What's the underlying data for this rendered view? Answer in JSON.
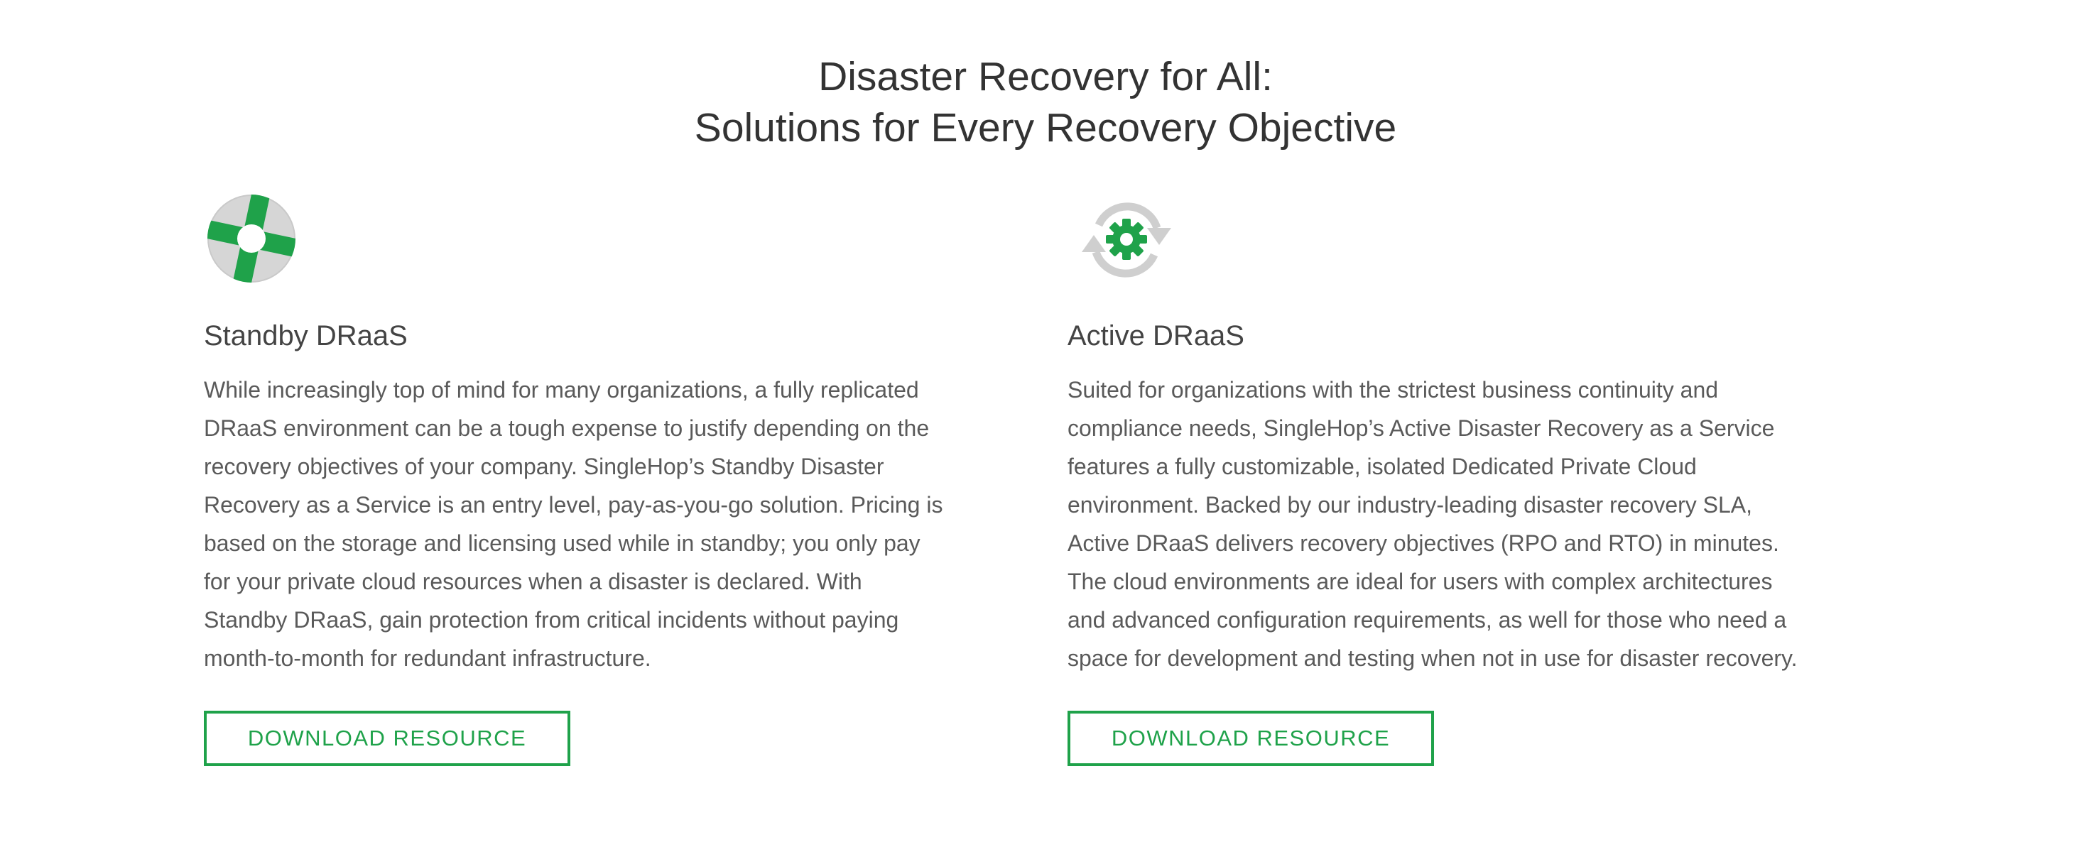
{
  "heading": {
    "line1": "Disaster Recovery for All:",
    "line2": "Solutions for Every Recovery Objective"
  },
  "colors": {
    "accent": "#1fa24a",
    "icon_gray": "#d6d6d6",
    "heading_text": "#333333",
    "body_text": "#5a5a5a"
  },
  "cards": [
    {
      "icon": "lifebuoy-icon",
      "title": "Standby DRaaS",
      "body_lines": [
        "While increasingly top of mind for many organizations, a fully replicated",
        "DRaaS environment can be a tough expense to justify depending on the",
        "recovery objectives of your company. SingleHop’s Standby Disaster",
        "Recovery as a Service is an entry level, pay-as-you-go solution. Pricing is",
        "based on the storage and licensing used while in standby; you only pay",
        "for your private cloud resources when a disaster is declared. With",
        "Standby DRaaS, gain protection from critical incidents without paying",
        "month-to-month for redundant infrastructure."
      ],
      "button_label": "DOWNLOAD RESOURCE"
    },
    {
      "icon": "gear-sync-icon",
      "title": "Active DRaaS",
      "body_lines": [
        "Suited for organizations with the strictest business continuity and",
        "compliance needs, SingleHop’s Active Disaster Recovery as a Service",
        "features a fully customizable, isolated Dedicated Private Cloud",
        "environment. Backed by our industry-leading disaster recovery SLA,",
        "Active DRaaS delivers recovery objectives (RPO and RTO) in minutes.",
        "The cloud environments are ideal for users with complex architectures",
        "and advanced configuration requirements, as well for those who need a",
        "space for development and testing when not in use for disaster recovery."
      ],
      "button_label": "DOWNLOAD RESOURCE"
    }
  ]
}
